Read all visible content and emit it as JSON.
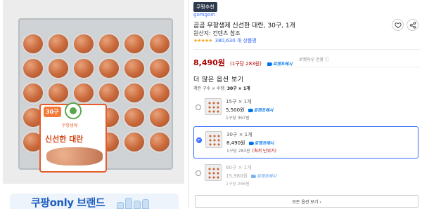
{
  "image_panel": {
    "label_badge": "30구",
    "label_title": "신선한 대란",
    "label_tag": "무항생제",
    "banner_text": "쿠팡only 브랜드"
  },
  "product": {
    "badge": "쿠팡추천",
    "brand": "gomgom",
    "title": "곰곰 무항생제 신선한 대란, 30구, 1개",
    "origin": "원산지: 컨텐츠 참조",
    "stars": "★★★★★",
    "rating_count": "380,630 개 상품평",
    "price": "8,490원",
    "unit_price": "(1구당 283원)",
    "rocket_label": "로켓프레시",
    "delivery_note": "로켓와우 전용 ⓘ"
  },
  "options_section": {
    "title": "더 많은 옵션 보기",
    "selected_prefix": "계란 구수 × 수량:",
    "selected_value": "30구 × 1개",
    "options": [
      {
        "qty": "15구 × 1개",
        "price": "5,500원",
        "rocket": "로켓프레시",
        "unit": "1구당 367원",
        "flag": "",
        "selected": false
      },
      {
        "qty": "30구 × 1개",
        "price": "8,490원",
        "rocket": "로켓프레시",
        "unit": "1구당 283원",
        "flag": "(최저 단위가)",
        "selected": true
      },
      {
        "qty": "60구 × 1개",
        "price": "15,980원",
        "rocket": "로켓프레시",
        "unit": "1구당 266원",
        "flag": "",
        "selected": false
      }
    ],
    "all_options_button": "모든 옵션 보기 ›"
  },
  "colors": {
    "price_red": "#ae0000",
    "link_blue": "#346aff",
    "rocket_blue": "#0073e9"
  },
  "icons": [
    "heart-icon",
    "share-icon",
    "radio-icon"
  ]
}
